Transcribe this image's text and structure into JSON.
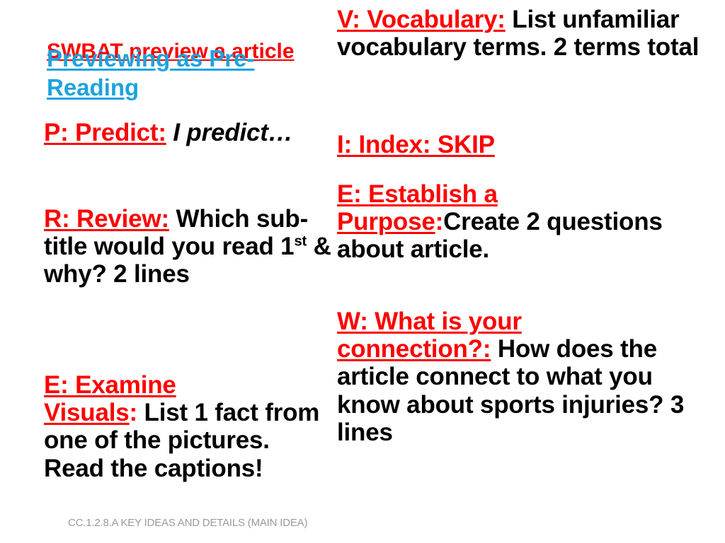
{
  "slide": {
    "title_overlay_red": "SWBAT preview a article",
    "title_overlay_blue": "Previewing as Pre-Reading",
    "footer_code": "CC.1.2.8.A KEY IDEAS AND DETAILS (MAIN IDEA)",
    "colors": {
      "accent_red": "#FF0000",
      "accent_blue": "#1CA3DE",
      "body_text": "#000000",
      "footer_text": "#9A9A9A",
      "background": "#FFFFFF"
    }
  },
  "left_column": {
    "items": [
      {
        "label": "P: Predict:",
        "body_prefix": " I predict…",
        "body_suffix": "",
        "italic": true
      },
      {
        "label": "R: Review:",
        "body_prefix": "  Which sub-title would you read 1",
        "superscript": "st",
        "body_suffix": " & why?  2 lines",
        "italic": false
      },
      {
        "label_line1": "E: Examine",
        "label_line2": "Visuals",
        "label_colon": ":",
        "body_suffix": "  List 1 fact from one of the pictures.  Read the captions!",
        "italic": false
      }
    ]
  },
  "right_column": {
    "items": [
      {
        "label": "V: Vocabulary:",
        "body_suffix": "  List unfamiliar vocabulary terms. 2 terms total"
      },
      {
        "label": "I:  Index: SKIP",
        "body_suffix": ""
      },
      {
        "label_line1": "E:  Establish a",
        "label_line2": "Purpose",
        "label_colon": ":",
        "body_suffix": "Create 2 questions about article."
      },
      {
        "label_line1": "W:  What is your",
        "label_line2": "connection?:",
        "body_suffix": " How does the article connect to what you know about sports injuries? 3 lines"
      }
    ]
  }
}
